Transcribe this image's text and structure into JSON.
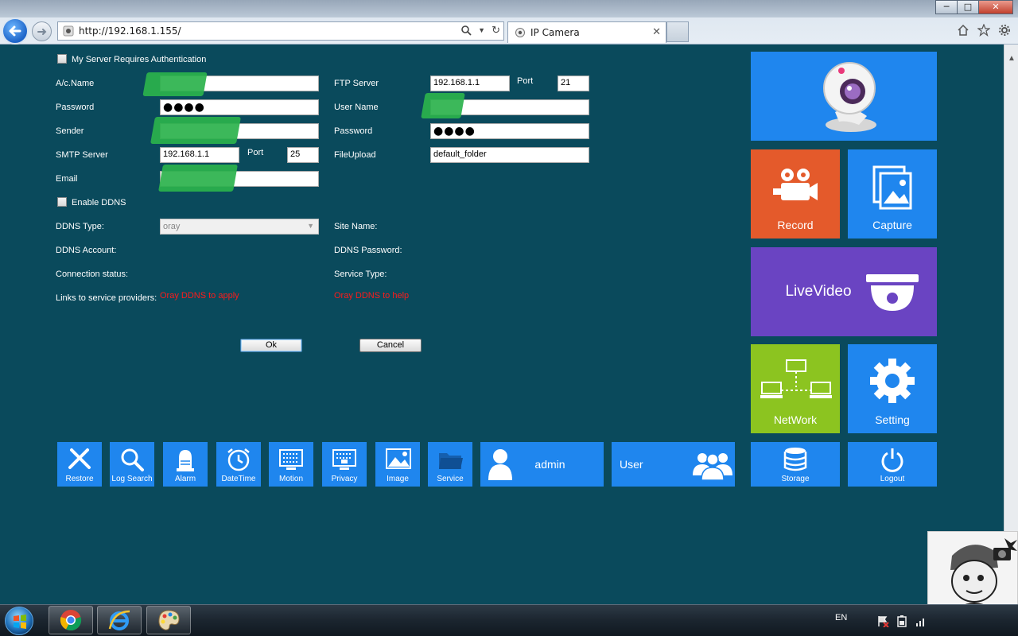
{
  "browser": {
    "url": "http://192.168.1.155/",
    "tab_title": "IP Camera",
    "window_buttons": [
      "─",
      "□",
      "✕"
    ]
  },
  "form": {
    "auth_label": "My Server Requires Authentication",
    "acname_label": "A/c.Name",
    "password_label": "Password",
    "password_value": "●●●●",
    "sender_label": "Sender",
    "smtp_server_label": "SMTP Server",
    "smtp_server_value": "192.168.1.1",
    "smtp_port_label": "Port",
    "smtp_port_value": "25",
    "email_label": "Email",
    "ftp_server_label": "FTP Server",
    "ftp_server_value": "192.168.1.1",
    "ftp_port_label": "Port",
    "ftp_port_value": "21",
    "ftp_username_label": "User Name",
    "ftp_password_label": "Password",
    "ftp_password_value": "●●●●",
    "fileupload_label": "FileUpload",
    "fileupload_value": "default_folder",
    "enable_ddns_label": "Enable DDNS",
    "ddns_type_label": "DDNS Type:",
    "ddns_type_value": "oray",
    "site_name_label": "Site Name:",
    "ddns_account_label": "DDNS Account:",
    "ddns_password_label": "DDNS Password:",
    "connection_status_label": "Connection status:",
    "service_type_label": "Service Type:",
    "links_label": "Links to service providers:",
    "oray_apply_link": "Oray DDNS to apply",
    "oray_help_link": "Oray DDNS to help",
    "ok_label": "Ok",
    "cancel_label": "Cancel"
  },
  "tiles": {
    "record": "Record",
    "capture": "Capture",
    "livevideo": "LiveVideo",
    "network": "NetWork",
    "setting": "Setting",
    "storage": "Storage",
    "logout": "Logout"
  },
  "toolbar": {
    "items": [
      "Restore",
      "Log Search",
      "Alarm",
      "DateTime",
      "Motion",
      "Privacy",
      "Image",
      "Service"
    ],
    "admin": "admin",
    "user": "User"
  },
  "taskbar": {
    "lang": "EN"
  },
  "colors": {
    "background": "#0a4a5c",
    "tile_blue": "#1f86ee",
    "tile_orange": "#e45a2b",
    "tile_purple": "#6a44c2",
    "tile_green": "#8cc420",
    "link_red": "#ff1a1a"
  }
}
